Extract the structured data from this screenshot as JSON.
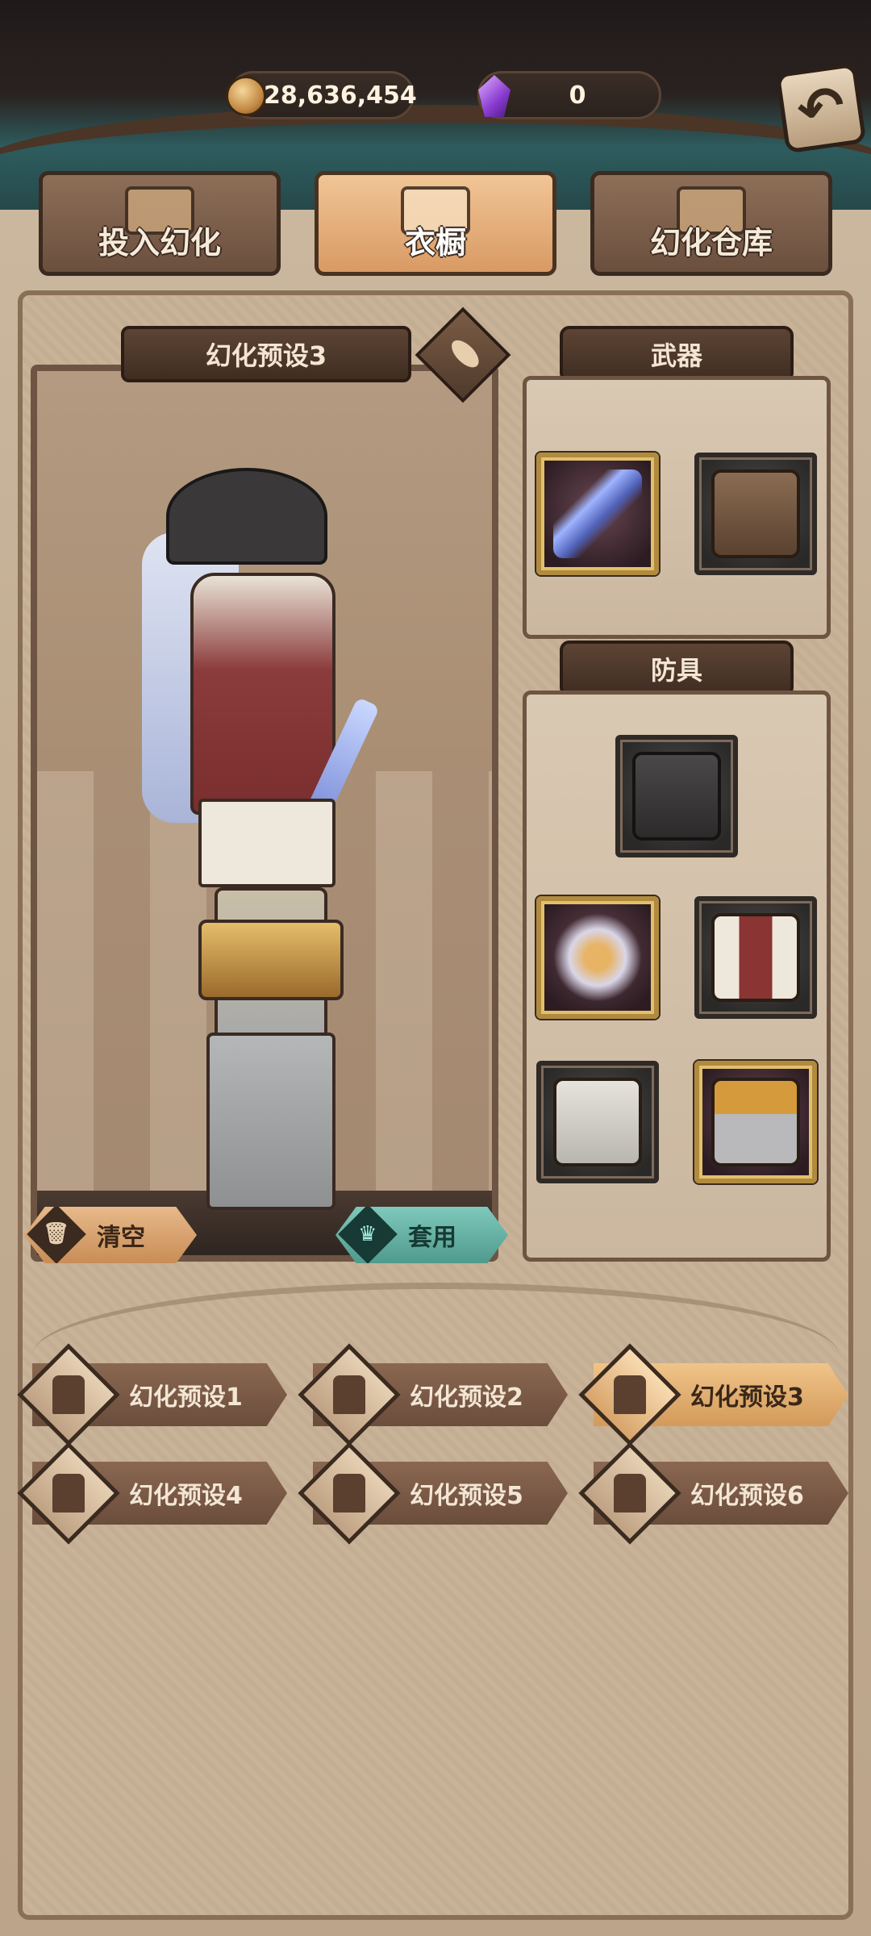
{
  "currency": {
    "coins": "28,636,454",
    "gems": "0",
    "coin_icon": "gold-coin-icon",
    "gem_icon": "purple-crystal-icon"
  },
  "tabs": [
    {
      "label": "投入幻化",
      "icon": "mask-icon",
      "active": false
    },
    {
      "label": "衣橱",
      "icon": "wardrobe-crest-icon",
      "active": true
    },
    {
      "label": "幻化仓库",
      "icon": "cabinet-icon",
      "active": false
    }
  ],
  "preset": {
    "current_name": "幻化预设3",
    "clear_label": "清空",
    "apply_label": "套用"
  },
  "sections": {
    "weapon_label": "武器",
    "armor_label": "防具"
  },
  "weapon_slots": [
    {
      "item": "crystal-blade",
      "rarity": "gold"
    },
    {
      "item": "tool-pouch",
      "rarity": "gray"
    }
  ],
  "armor_slots": [
    {
      "item": "tricorn-hat",
      "rarity": "gray"
    },
    {
      "item": "feather-glove",
      "rarity": "gold"
    },
    {
      "item": "corset-coat",
      "rarity": "gray"
    },
    {
      "item": "white-breeches",
      "rarity": "gray"
    },
    {
      "item": "armored-boots",
      "rarity": "gold"
    }
  ],
  "presets": [
    {
      "label": "幻化预设1",
      "active": false
    },
    {
      "label": "幻化预设2",
      "active": false
    },
    {
      "label": "幻化预设3",
      "active": true
    },
    {
      "label": "幻化预设4",
      "active": false
    },
    {
      "label": "幻化预设5",
      "active": false
    },
    {
      "label": "幻化预设6",
      "active": false
    }
  ],
  "colors": {
    "accent_orange": "#d99a64",
    "accent_teal": "#4f9a8d",
    "frame_brown": "#6e5543"
  }
}
